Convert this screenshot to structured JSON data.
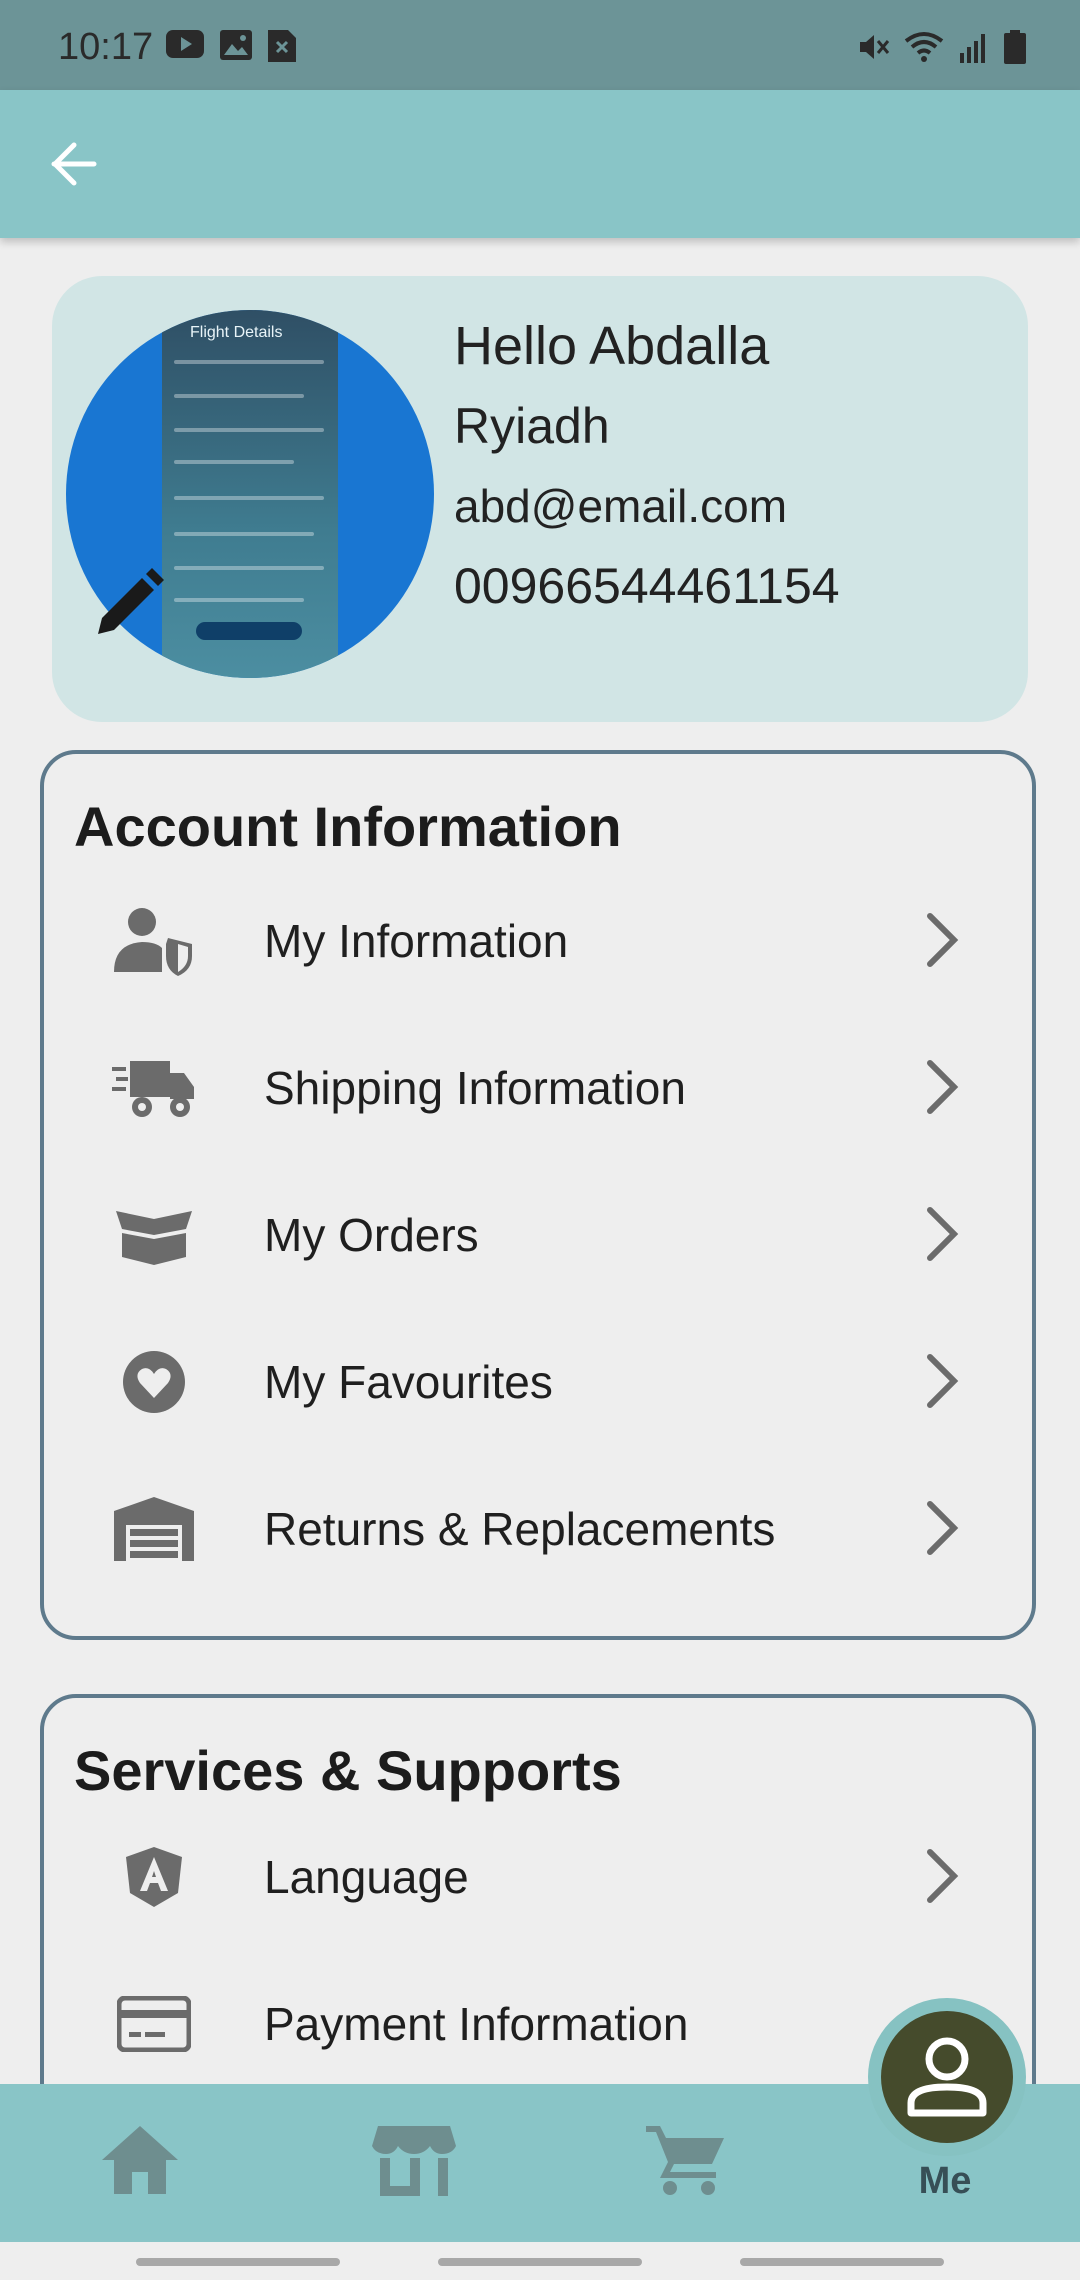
{
  "status_bar": {
    "time": "10:17",
    "left_icons": [
      "youtube-icon",
      "gallery-icon",
      "sim-x-icon"
    ],
    "right_icons": [
      "mute-vibrate-icon",
      "wifi-icon",
      "signal-icon",
      "battery-icon"
    ]
  },
  "app_bar": {
    "back_icon": "arrow-back-icon"
  },
  "profile": {
    "greeting": "Hello Abdalla",
    "city": "Ryiadh",
    "email": "abd@email.com",
    "phone": "00966544461154",
    "avatar_screen_title": "Flight Details",
    "edit_icon": "pencil-icon"
  },
  "account_section": {
    "title": "Account Information",
    "items": [
      {
        "label": "My Information",
        "icon": "user-shield-icon"
      },
      {
        "label": "Shipping Information",
        "icon": "shipping-truck-icon"
      },
      {
        "label": "My Orders",
        "icon": "open-box-icon"
      },
      {
        "label": "My Favourites",
        "icon": "heart-circle-icon"
      },
      {
        "label": "Returns & Replacements",
        "icon": "warehouse-icon"
      }
    ]
  },
  "services_section": {
    "title": "Services & Supports",
    "items": [
      {
        "label": "Language",
        "icon": "angular-shield-icon"
      },
      {
        "label": "Payment Information",
        "icon": "credit-card-icon"
      }
    ]
  },
  "bottom_nav": {
    "items": [
      {
        "icon": "home-icon"
      },
      {
        "icon": "store-icon"
      },
      {
        "icon": "cart-icon"
      },
      {
        "icon": "person-icon",
        "label": "Me",
        "active": true
      }
    ]
  },
  "colors": {
    "app_bar": "#89c5c7",
    "status_bar": "#6c9497",
    "profile_card": "#d1e5e5",
    "section_border": "#5e7a8c",
    "me_button": "#454b2c"
  }
}
